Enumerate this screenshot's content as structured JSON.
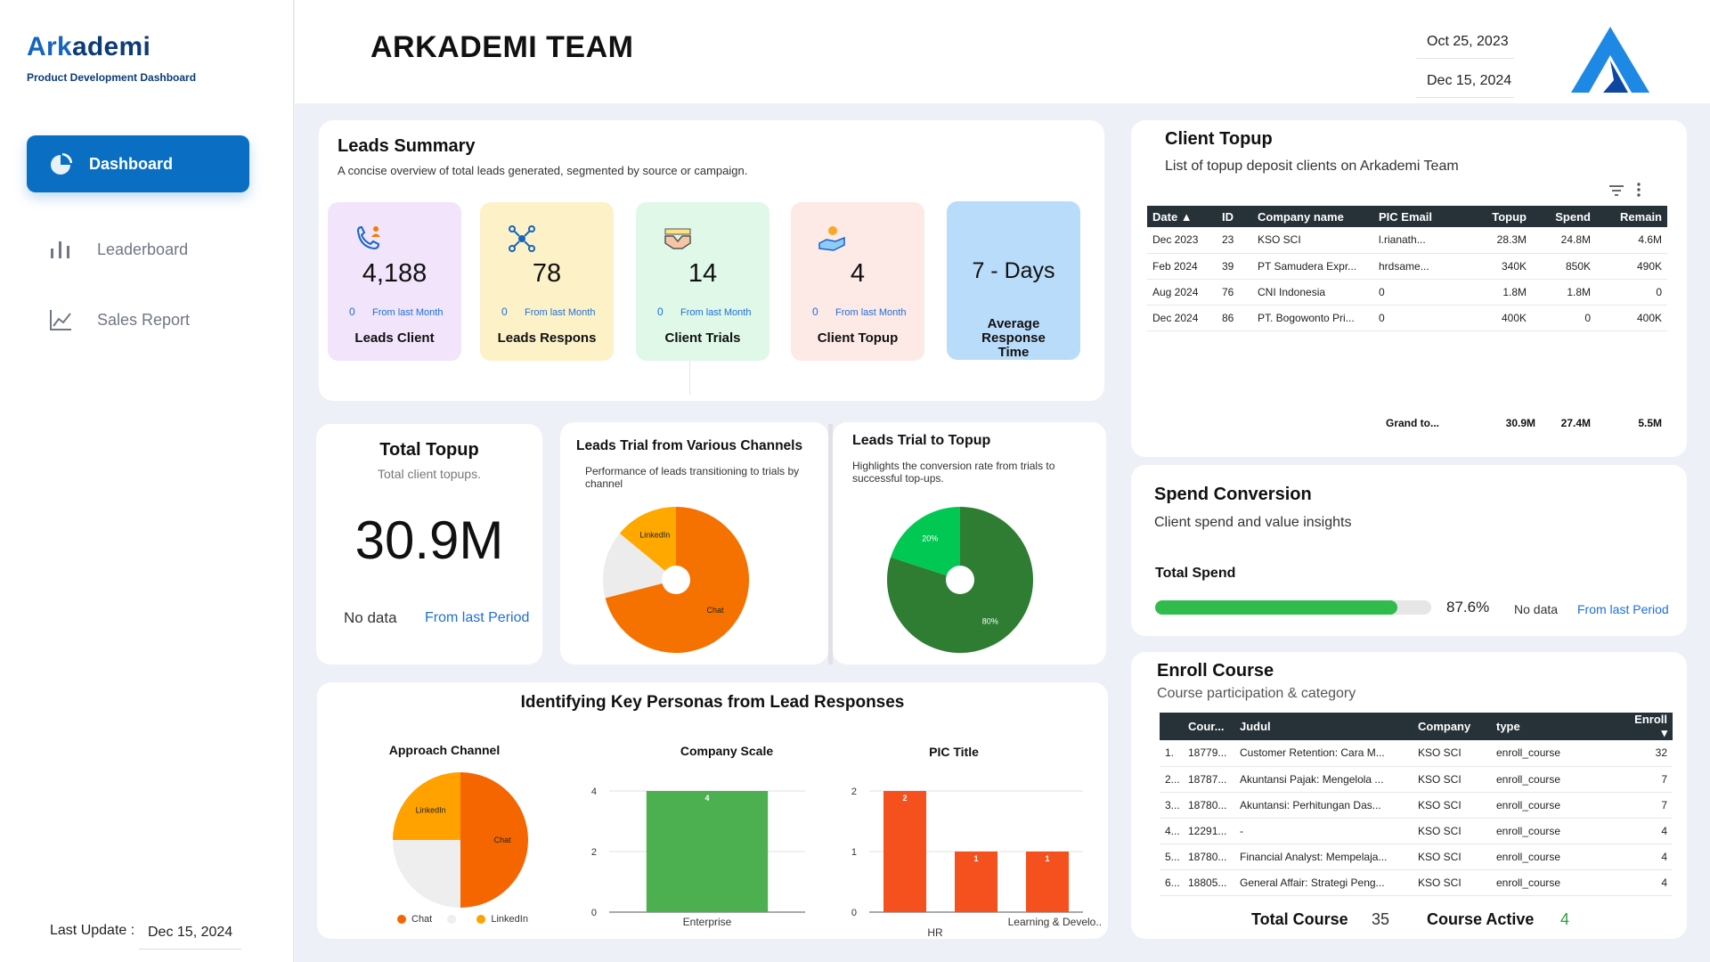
{
  "brand": {
    "name_part1": "Ark",
    "name_part2": "ademi",
    "subtitle": "Product Development Dashboard"
  },
  "sidebar": {
    "items": [
      {
        "label": "Dashboard",
        "icon": "pie-chart-icon",
        "active": true
      },
      {
        "label": "Leaderboard",
        "icon": "bar-chart-icon",
        "active": false
      },
      {
        "label": "Sales Report",
        "icon": "line-chart-icon",
        "active": false
      }
    ],
    "last_update_label": "Last Update :",
    "last_update_value": "Dec 15, 2024"
  },
  "header": {
    "title": "ARKADEMI TEAM",
    "date_start": "Oct 25, 2023",
    "date_end": "Dec 15, 2024"
  },
  "leads_summary": {
    "title": "Leads Summary",
    "subtitle": "A concise overview of total leads generated, segmented by source or campaign.",
    "kpis": [
      {
        "value": "4,188",
        "delta": "0",
        "delta_label": "From last Month",
        "label": "Leads Client",
        "bg": "#f1e4fb",
        "icon": "phone-user-icon"
      },
      {
        "value": "78",
        "delta": "0",
        "delta_label": "From last Month",
        "label": "Leads Respons",
        "bg": "#fdf1c8",
        "icon": "network-icon"
      },
      {
        "value": "14",
        "delta": "0",
        "delta_label": "From last Month",
        "label": "Client Trials",
        "bg": "#dff8e7",
        "icon": "handshake-icon"
      },
      {
        "value": "4",
        "delta": "0",
        "delta_label": "From last Month",
        "label": "Client Topup",
        "bg": "#fde9e6",
        "icon": "coin-hand-icon"
      }
    ],
    "response": {
      "value": "7 - Days",
      "label": "Average Response Time",
      "bg": "#b9dcfa"
    }
  },
  "total_topup": {
    "title": "Total Topup",
    "subtitle": "Total client topups.",
    "value": "30.9M",
    "no_data": "No data",
    "from": "From last Period"
  },
  "leads_trial": {
    "title": "Leads Trial from Various Channels",
    "subtitle": "Performance of leads transitioning to trials by channel",
    "slices": [
      {
        "label": "Chat",
        "value": 71,
        "color": "#f57200"
      },
      {
        "label": "",
        "value": 15,
        "color": "#ececec"
      },
      {
        "label": "LinkedIn",
        "value": 14,
        "color": "#ffa800"
      }
    ]
  },
  "trial_topup": {
    "title": "Leads Trial to Topup",
    "subtitle": "Highlights the conversion rate from trials to successful top-ups.",
    "slices": [
      {
        "label": "80%",
        "value": 80,
        "color": "#2e7d32"
      },
      {
        "label": "20%",
        "value": 20,
        "color": "#00c853"
      }
    ]
  },
  "personas": {
    "title": "Identifying Key Personas from Lead Responses",
    "approach": {
      "title": "Approach Channel",
      "slices": [
        {
          "label": "Chat",
          "value": 50,
          "color": "#f56600"
        },
        {
          "label": "",
          "value": 25,
          "color": "#eeeeee"
        },
        {
          "label": "LinkedIn",
          "value": 25,
          "color": "#ffa200"
        }
      ],
      "legend": [
        {
          "label": "Chat",
          "color": "#f56600"
        },
        {
          "label": "",
          "color": "#eeeeee"
        },
        {
          "label": "LinkedIn",
          "color": "#ffa200"
        }
      ]
    },
    "company_scale": {
      "title": "Company Scale",
      "chart_data": {
        "type": "bar",
        "categories": [
          "Enterprise"
        ],
        "values": [
          4
        ],
        "ylim": [
          0,
          4
        ],
        "yticks": [
          "0",
          "2",
          "4"
        ],
        "color": "#4caf50"
      }
    },
    "pic_title": {
      "title": "PIC Title",
      "chart_data": {
        "type": "bar",
        "categories": [
          "",
          "HR",
          "Learning & Develo..."
        ],
        "values": [
          2,
          1,
          1
        ],
        "ylim": [
          0,
          2
        ],
        "yticks": [
          "0",
          "1",
          "2"
        ],
        "color": "#f4511e"
      }
    }
  },
  "client_topup": {
    "title": "Client Topup",
    "subtitle": "List of topup deposit clients on Arkademi Team",
    "columns": [
      "Date ▲",
      "ID",
      "Company name",
      "PIC Email",
      "Topup",
      "Spend",
      "Remain"
    ],
    "rows": [
      [
        "Dec 2023",
        "23",
        "KSO SCI",
        "l.rianath...",
        "28.3M",
        "24.8M",
        "4.6M"
      ],
      [
        "Feb 2024",
        "39",
        "PT Samudera Expr...",
        "hrdsame...",
        "340K",
        "850K",
        "490K"
      ],
      [
        "Aug 2024",
        "76",
        "CNI Indonesia",
        "0",
        "1.8M",
        "1.8M",
        "0"
      ],
      [
        "Dec 2024",
        "86",
        "PT. Bogowonto Pri...",
        "0",
        "400K",
        "0",
        "400K"
      ]
    ],
    "total": {
      "label": "Grand to...",
      "topup": "30.9M",
      "spend": "27.4M",
      "remain": "5.5M"
    }
  },
  "spend_conversion": {
    "title": "Spend Conversion",
    "subtitle": "Client spend and value insights",
    "metric_label": "Total Spend",
    "percent_text": "87.6%",
    "progress": 0.876,
    "no_data": "No data",
    "from": "From last Period"
  },
  "enroll": {
    "title": "Enroll Course",
    "subtitle": "Course participation & category",
    "columns": [
      "Cour...",
      "Judul",
      "Company",
      "type",
      "Enroll ▾"
    ],
    "rows": [
      [
        "1.",
        "18779...",
        "Customer Retention: Cara M...",
        "KSO SCI",
        "enroll_course",
        "32"
      ],
      [
        "2...",
        "18787...",
        "Akuntansi Pajak: Mengelola ...",
        "KSO SCI",
        "enroll_course",
        "7"
      ],
      [
        "3...",
        "18780...",
        "Akuntansi: Perhitungan Das...",
        "KSO SCI",
        "enroll_course",
        "7"
      ],
      [
        "4...",
        "12291...",
        "-",
        "KSO SCI",
        "enroll_course",
        "4"
      ],
      [
        "5...",
        "18780...",
        "Financial Analyst: Mempelaja...",
        "KSO SCI",
        "enroll_course",
        "4"
      ],
      [
        "6...",
        "18805...",
        "General Affair: Strategi Peng...",
        "KSO SCI",
        "enroll_course",
        "4"
      ]
    ],
    "total_course_label": "Total Course",
    "total_course": "35",
    "active_label": "Course Active",
    "active": "4"
  }
}
